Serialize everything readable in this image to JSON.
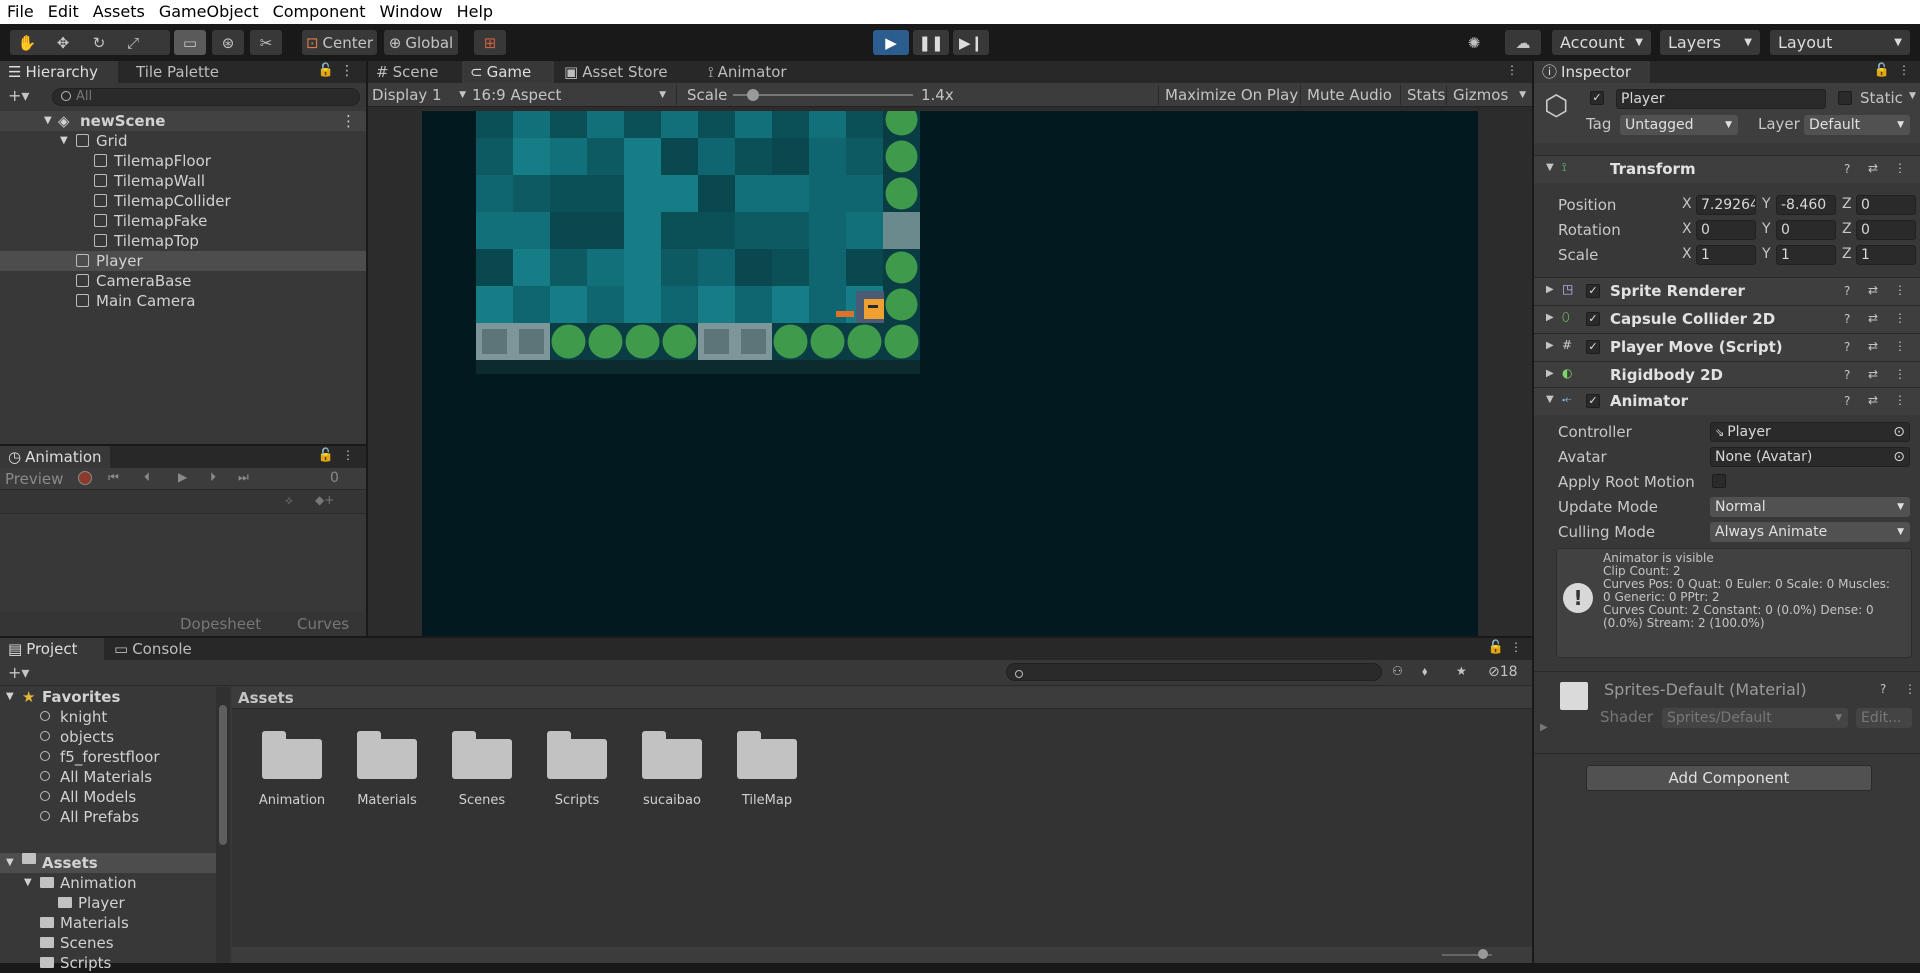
{
  "menu": [
    "File",
    "Edit",
    "Assets",
    "GameObject",
    "Component",
    "Window",
    "Help"
  ],
  "toolbar": {
    "pivot": "Center",
    "space": "Global",
    "account": "Account",
    "layers": "Layers",
    "layout": "Layout"
  },
  "hierarchy": {
    "tabs": [
      "Hierarchy",
      "Tile Palette"
    ],
    "search_placeholder": "All",
    "scene": "newScene",
    "items": [
      {
        "label": "Grid",
        "depth": 1,
        "expanded": true
      },
      {
        "label": "TilemapFloor",
        "depth": 2
      },
      {
        "label": "TilemapWall",
        "depth": 2
      },
      {
        "label": "TilemapCollider",
        "depth": 2
      },
      {
        "label": "TilemapFake",
        "depth": 2
      },
      {
        "label": "TilemapTop",
        "depth": 2
      },
      {
        "label": "Player",
        "depth": 1,
        "selected": true
      },
      {
        "label": "CameraBase",
        "depth": 1
      },
      {
        "label": "Main Camera",
        "depth": 1
      }
    ]
  },
  "animation": {
    "tab": "Animation",
    "preview": "Preview",
    "frame": "0",
    "dopesheet": "Dopesheet",
    "curves": "Curves"
  },
  "game": {
    "tabs": [
      "Scene",
      "Game",
      "Asset Store",
      "Animator"
    ],
    "display": "Display 1",
    "aspect": "16:9 Aspect",
    "scale_label": "Scale",
    "scale_value": "1.4x",
    "scale_fraction": 0.08,
    "maximize": "Maximize On Play",
    "mute": "Mute Audio",
    "stats": "Stats",
    "gizmos": "Gizmos"
  },
  "inspector": {
    "tab": "Inspector",
    "object_name": "Player",
    "static": "Static",
    "tag_label": "Tag",
    "tag": "Untagged",
    "layer_label": "Layer",
    "layer": "Default",
    "transform": {
      "title": "Transform",
      "position_label": "Position",
      "rotation_label": "Rotation",
      "scale_label": "Scale",
      "position": [
        "7.29264",
        "-8.460",
        "0"
      ],
      "rotation": [
        "0",
        "0",
        "0"
      ],
      "scale": [
        "1",
        "1",
        "1"
      ]
    },
    "components": [
      "Sprite Renderer",
      "Capsule Collider 2D",
      "Player Move (Script)",
      "Rigidbody 2D"
    ],
    "animator": {
      "title": "Animator",
      "controller_label": "Controller",
      "controller": "Player",
      "avatar_label": "Avatar",
      "avatar": "None (Avatar)",
      "root_motion_label": "Apply Root Motion",
      "update_label": "Update Mode",
      "update": "Normal",
      "culling_label": "Culling Mode",
      "culling": "Always Animate",
      "info": [
        "Animator is visible",
        "Clip Count: 2",
        "Curves Pos: 0 Quat: 0 Euler: 0 Scale: 0 Muscles:",
        "0 Generic: 0 PPtr: 2",
        "Curves Count: 2 Constant: 0 (0.0%) Dense: 0",
        "(0.0%) Stream: 2 (100.0%)"
      ]
    },
    "material": {
      "title": "Sprites-Default (Material)",
      "shader_label": "Shader",
      "shader": "Sprites/Default",
      "edit": "Edit..."
    },
    "add_component": "Add Component"
  },
  "project": {
    "tabs": [
      "Project",
      "Console"
    ],
    "hidden_count": "18",
    "favorites_label": "Favorites",
    "favorites": [
      "knight",
      "objects",
      "f5_forestfloor",
      "All Materials",
      "All Models",
      "All Prefabs"
    ],
    "assets_label": "Assets",
    "tree": [
      {
        "label": "Animation",
        "depth": 1,
        "expanded": true
      },
      {
        "label": "Player",
        "depth": 2
      },
      {
        "label": "Materials",
        "depth": 1
      },
      {
        "label": "Scenes",
        "depth": 1
      },
      {
        "label": "Scripts",
        "depth": 1
      }
    ],
    "breadcrumb": "Assets",
    "folders": [
      "Animation",
      "Materials",
      "Scenes",
      "Scripts",
      "sucaibao",
      "TileMap"
    ]
  },
  "colors": {
    "accent_blue": "#3a72b0",
    "selection": "#4d4d4d",
    "game_bg": "#021a1f",
    "wall_teal": "#0d5a63",
    "bush_green": "#3f9a4c"
  }
}
